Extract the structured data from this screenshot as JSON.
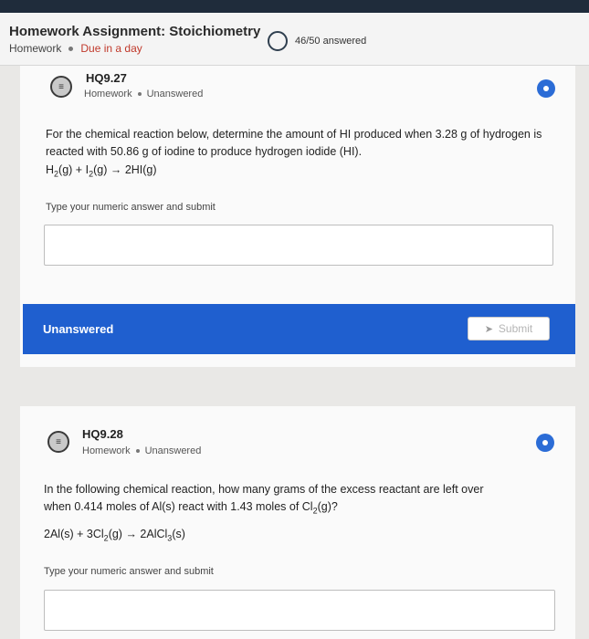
{
  "header": {
    "title": "Homework Assignment: Stoichiometry",
    "type_label": "Homework",
    "due_label": "Due in a day",
    "progress_text": "46/50 answered"
  },
  "questions": [
    {
      "id": "HQ9.27",
      "type": "Homework",
      "status": "Unanswered",
      "text": "For the chemical reaction below, determine the amount of HI produced when 3.28 g of hydrogen is reacted with 50.86 g of iodine to produce hydrogen iodide (HI).",
      "equation": {
        "r1": "H",
        "r1_sub": "2",
        "r1_state": "(g)",
        "plus": " + ",
        "r2": "I",
        "r2_sub": "2",
        "r2_state": "(g)",
        "arrow": " → ",
        "p1": "2HI(g)"
      },
      "hint": "Type your numeric answer and submit",
      "answer_value": "",
      "status_bar_label": "Unanswered",
      "submit_label": "Submit"
    },
    {
      "id": "HQ9.28",
      "type": "Homework",
      "status": "Unanswered",
      "text_a": "In the following chemical reaction, how many grams of the excess reactant are left over",
      "text_b": "when 0.414 moles of Al(s) react with 1.43 moles of Cl",
      "text_b_sub": "2",
      "text_b_end": "(g)?",
      "equation": {
        "r1": "2Al(s)",
        "plus": " + ",
        "r2": "3Cl",
        "r2_sub": "2",
        "r2_state": "(g)",
        "arrow": " → ",
        "p1": "2AlCl",
        "p1_sub": "3",
        "p1_state": "(s)"
      },
      "hint": "Type your numeric answer and submit",
      "answer_value": ""
    }
  ],
  "icons": {
    "question": "list-icon",
    "flag": "circle-dot-icon",
    "progress": "progress-ring-icon",
    "submit": "send-icon"
  },
  "colors": {
    "accent": "#1f5fcf",
    "due": "#c0392b",
    "topbar": "#1f2c3b"
  }
}
